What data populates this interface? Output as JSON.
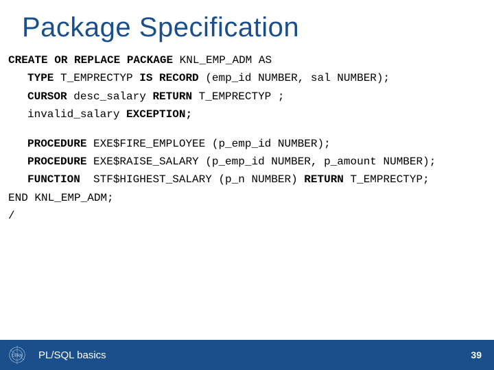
{
  "title": "Package Specification",
  "code": {
    "l1_kw1": "CREATE OR REPLACE PACKAGE",
    "l1_rest": " KNL_EMP_ADM AS",
    "l2_kw1": "TYPE",
    "l2_mid": " T_EMPRECTYP ",
    "l2_kw2": "IS RECORD",
    "l2_rest": " (emp_id NUMBER, sal NUMBER);",
    "l3_kw1": "CURSOR",
    "l3_mid": " desc_salary ",
    "l3_kw2": "RETURN",
    "l3_rest": " T_EMPRECTYP ;",
    "l4_pre": "invalid_salary ",
    "l4_kw": "EXCEPTION;",
    "l5_kw": "PROCEDURE",
    "l5_rest": " EXE$FIRE_EMPLOYEE (p_emp_id NUMBER);",
    "l6_kw": "PROCEDURE",
    "l6_rest": " EXE$RAISE_SALARY (p_emp_id NUMBER, p_amount NUMBER);",
    "l7_kw": "FUNCTION ",
    "l7_mid": " STF$HIGHEST_SALARY (p_n NUMBER) ",
    "l7_kw2": "RETURN",
    "l7_rest": " T_EMPRECTYP;",
    "l8": "END KNL_EMP_ADM;",
    "l9": "/"
  },
  "footer": {
    "title": "PL/SQL basics",
    "page": "39",
    "logo": "CERN"
  }
}
